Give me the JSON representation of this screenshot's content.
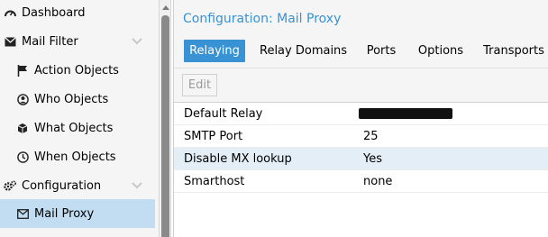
{
  "sidebar": {
    "items": [
      {
        "label": "Dashboard",
        "icon": "dashboard-icon"
      },
      {
        "label": "Mail Filter",
        "icon": "envelope-icon"
      },
      {
        "label": "Action Objects",
        "icon": "flag-icon"
      },
      {
        "label": "Who Objects",
        "icon": "user-icon"
      },
      {
        "label": "What Objects",
        "icon": "cube-icon"
      },
      {
        "label": "When Objects",
        "icon": "clock-icon"
      },
      {
        "label": "Configuration",
        "icon": "gears-icon"
      },
      {
        "label": "Mail Proxy",
        "icon": "envelope-open-icon",
        "selected": true
      }
    ]
  },
  "panel": {
    "title": "Configuration: Mail Proxy",
    "tabs": [
      "Relaying",
      "Relay Domains",
      "Ports",
      "Options",
      "Transports"
    ],
    "active_tab": "Relaying",
    "toolbar": {
      "edit_label": "Edit"
    }
  },
  "grid": {
    "rows": [
      {
        "key": "Default Relay",
        "value": "",
        "redacted": true
      },
      {
        "key": "SMTP Port",
        "value": "25"
      },
      {
        "key": "Disable MX lookup",
        "value": "Yes"
      },
      {
        "key": "Smarthost",
        "value": "none"
      }
    ]
  },
  "colors": {
    "accent": "#3892d4",
    "selected": "#c2ddf2",
    "row_alt": "#e3eef7"
  }
}
